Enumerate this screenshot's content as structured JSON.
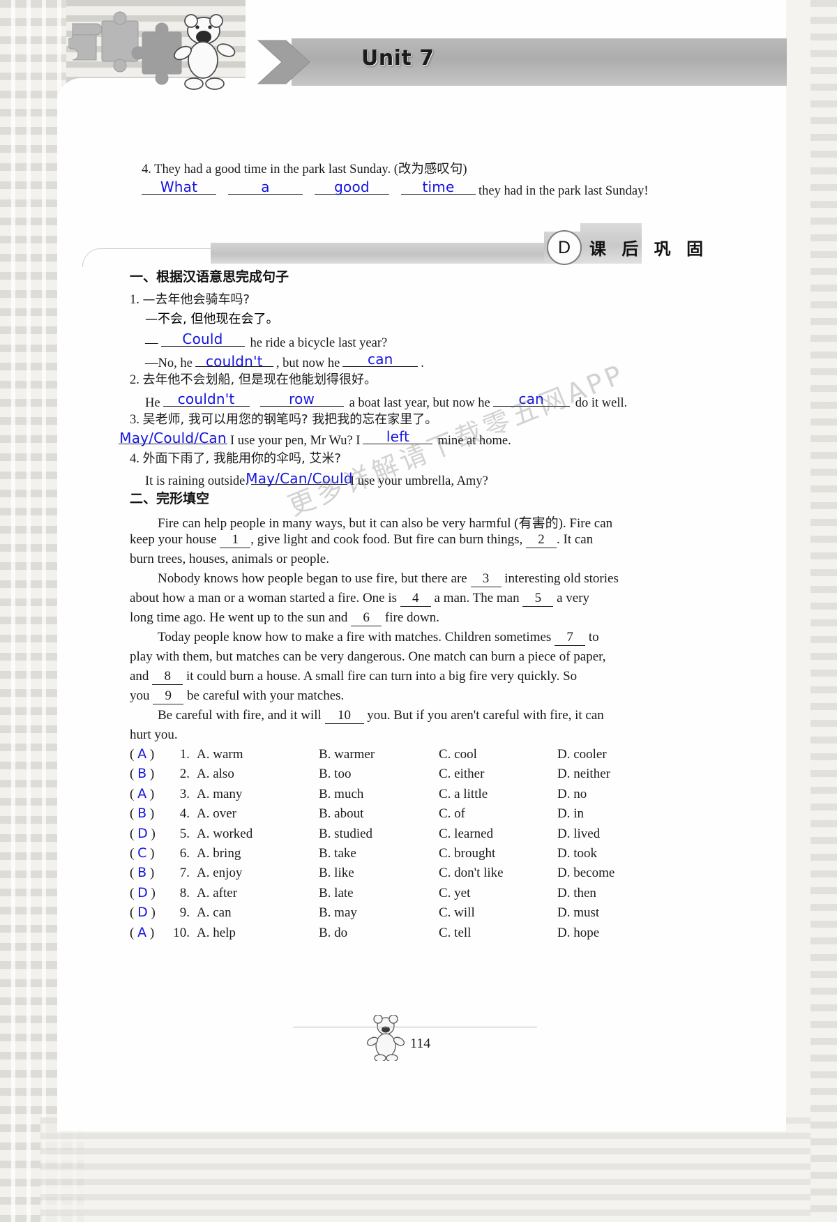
{
  "header": {
    "unit_title": "Unit 7",
    "puzzle_icon": "puzzle-pieces-icon",
    "mascot_icon": "bear-mascot-icon"
  },
  "question_4_top": {
    "prompt": "4. They had a good time in the park last Sunday. (改为感叹句)",
    "answers": [
      "What",
      "a",
      "good",
      "time"
    ],
    "tail": "they had in the park last Sunday!"
  },
  "section_d": {
    "badge": "D",
    "title": "课 后 巩 固"
  },
  "part_one": {
    "heading": "一、根据汉语意思完成句子",
    "items": [
      {
        "number": "1.",
        "cn_lines": [
          "—去年他会骑车吗?",
          "—不会, 但他现在会了。"
        ],
        "en_line_1_prefix": "—",
        "en_line_1_answer": "Could",
        "en_line_1_rest": "he ride a bicycle last year?",
        "en_line_2_prefix": "—No, he",
        "en_line_2_answer_a": "couldn't",
        "en_line_2_mid": ", but now he",
        "en_line_2_answer_b": "can",
        "en_line_2_tail": "."
      },
      {
        "number": "2.",
        "cn_lines": [
          "去年他不会划船, 但是现在他能划得很好。"
        ],
        "prefix": "He",
        "answer_a": "couldn't",
        "answer_b": "row",
        "mid": "a boat last year, but now he",
        "answer_c": "can",
        "tail": "do it well."
      },
      {
        "number": "3.",
        "cn_lines": [
          "吴老师, 我可以用您的钢笔吗? 我把我的忘在家里了。"
        ],
        "answer_a": "May/Could/Can",
        "mid": "I use your pen, Mr Wu? I",
        "answer_b": "left",
        "tail": "mine at home."
      },
      {
        "number": "4.",
        "cn_lines": [
          "外面下雨了, 我能用你的伞吗, 艾米?"
        ],
        "prefix": "It is raining outside.",
        "answer_a": "May/Can/Could",
        "tail": "I use your umbrella, Amy?"
      }
    ]
  },
  "part_two": {
    "heading": "二、完形填空",
    "passage": [
      {
        "indent": true,
        "segments": [
          {
            "t": "Fire can help people in many ways, but it can also be very harmful (有害的). Fire can"
          }
        ]
      },
      {
        "indent": false,
        "segments": [
          {
            "t": "keep your house "
          },
          {
            "blank": "1"
          },
          {
            "t": ", give light and cook food. But fire can burn things, "
          },
          {
            "blank": "2"
          },
          {
            "t": ". It can"
          }
        ]
      },
      {
        "indent": false,
        "segments": [
          {
            "t": "burn trees, houses, animals or people."
          }
        ]
      },
      {
        "indent": true,
        "segments": [
          {
            "t": "Nobody knows how people began to use fire, but there are "
          },
          {
            "blank": "3"
          },
          {
            "t": " interesting old stories"
          }
        ]
      },
      {
        "indent": false,
        "segments": [
          {
            "t": "about how a man or a woman started a fire. One is "
          },
          {
            "blank": "4"
          },
          {
            "t": " a man. The man "
          },
          {
            "blank": "5"
          },
          {
            "t": " a very"
          }
        ]
      },
      {
        "indent": false,
        "segments": [
          {
            "t": "long time ago. He went up to the sun and "
          },
          {
            "blank": "6"
          },
          {
            "t": " fire down."
          }
        ]
      },
      {
        "indent": true,
        "segments": [
          {
            "t": "Today people know how to make a fire with matches. Children sometimes "
          },
          {
            "blank": "7"
          },
          {
            "t": " to"
          }
        ]
      },
      {
        "indent": false,
        "segments": [
          {
            "t": "play with them, but matches can be very dangerous. One match can burn a piece of paper,"
          }
        ]
      },
      {
        "indent": false,
        "segments": [
          {
            "t": "and "
          },
          {
            "blank": "8"
          },
          {
            "t": " it could burn a house. A small fire can turn into a big fire very quickly. So"
          }
        ]
      },
      {
        "indent": false,
        "segments": [
          {
            "t": "you "
          },
          {
            "blank": "9"
          },
          {
            "t": " be careful with your matches."
          }
        ]
      },
      {
        "indent": true,
        "segments": [
          {
            "t": "Be careful with fire, and it will "
          },
          {
            "blank": "10"
          },
          {
            "t": " you. But if you aren't careful with fire, it can"
          }
        ]
      },
      {
        "indent": false,
        "segments": [
          {
            "t": "hurt you."
          }
        ]
      }
    ],
    "options": [
      {
        "answer": "A",
        "num": "1.",
        "a": "A. warm",
        "b": "B. warmer",
        "c": "C. cool",
        "d": "D. cooler"
      },
      {
        "answer": "B",
        "num": "2.",
        "a": "A. also",
        "b": "B. too",
        "c": "C. either",
        "d": "D. neither"
      },
      {
        "answer": "A",
        "num": "3.",
        "a": "A. many",
        "b": "B. much",
        "c": "C. a little",
        "d": "D. no"
      },
      {
        "answer": "B",
        "num": "4.",
        "a": "A. over",
        "b": "B. about",
        "c": "C. of",
        "d": "D. in"
      },
      {
        "answer": "D",
        "num": "5.",
        "a": "A. worked",
        "b": "B. studied",
        "c": "C. learned",
        "d": "D. lived"
      },
      {
        "answer": "C",
        "num": "6.",
        "a": "A. bring",
        "b": "B. take",
        "c": "C. brought",
        "d": "D. took"
      },
      {
        "answer": "B",
        "num": "7.",
        "a": "A. enjoy",
        "b": "B. like",
        "c": "C. don't like",
        "d": "D. become"
      },
      {
        "answer": "D",
        "num": "8.",
        "a": "A. after",
        "b": "B. late",
        "c": "C. yet",
        "d": "D. then"
      },
      {
        "answer": "D",
        "num": "9.",
        "a": "A. can",
        "b": "B. may",
        "c": "C. will",
        "d": "D. must"
      },
      {
        "answer": "A",
        "num": "10.",
        "a": "A. help",
        "b": "B. do",
        "c": "C. tell",
        "d": "D. hope"
      }
    ]
  },
  "watermark": {
    "text_cn": "更多详解请下载零五网APP"
  },
  "footer": {
    "page_number": "114",
    "mascot_icon": "bear-mascot-icon"
  },
  "colors": {
    "answer_ink": "#1414e0",
    "banner_gray": "#b0b0b0",
    "page_bg": "#f4f3ef"
  }
}
